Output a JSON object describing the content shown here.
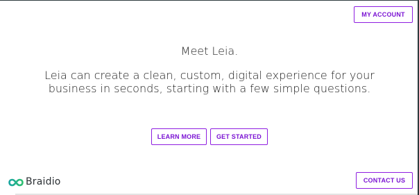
{
  "header": {
    "account_button_label": "MY ACCOUNT"
  },
  "hero": {
    "headline": "Meet Leia.",
    "description": "Leia can create a clean, custom, digital experience for your business in seconds, starting with a few simple questions.",
    "learn_more_label": "LEARN MORE",
    "get_started_label": "GET STARTED"
  },
  "footer": {
    "brand_name": "Braidio",
    "contact_button_label": "CONTACT US"
  },
  "colors": {
    "accent": "#8e1de0",
    "logo_teal": "#1aa6a0",
    "logo_green": "#2fbf71",
    "text": "#1d1d1d"
  },
  "icons": {
    "brand_logo": "braidio-logo-icon"
  }
}
